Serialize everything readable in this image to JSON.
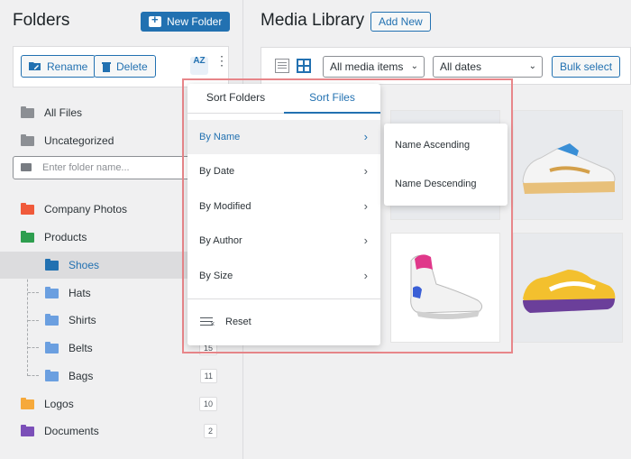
{
  "sidebar": {
    "title": "Folders",
    "new_folder_label": "New Folder",
    "rename_label": "Rename",
    "delete_label": "Delete",
    "sort_icon_text": "AZ",
    "items": [
      {
        "label": "All Files"
      },
      {
        "label": "Uncategorized"
      }
    ],
    "search_placeholder": "Enter folder name...",
    "folders": [
      {
        "label": "Company Photos",
        "color": "#f05a3b"
      },
      {
        "label": "Products",
        "color": "#2e9e4f"
      },
      {
        "label": "Shoes",
        "color": "#2271b1",
        "count": ""
      },
      {
        "label": "Hats",
        "color": "#6b9fe0",
        "count": ""
      },
      {
        "label": "Shirts",
        "color": "#6b9fe0",
        "count": ""
      },
      {
        "label": "Belts",
        "color": "#6b9fe0",
        "count": "15"
      },
      {
        "label": "Bags",
        "color": "#6b9fe0",
        "count": "11"
      },
      {
        "label": "Logos",
        "color": "#f6a93b",
        "count": "10"
      },
      {
        "label": "Documents",
        "color": "#7b4fb8",
        "count": "2"
      }
    ]
  },
  "media": {
    "title": "Media Library",
    "add_new_label": "Add New",
    "filter_items": "All media items",
    "filter_dates": "All dates",
    "bulk_select_label": "Bulk select"
  },
  "sort_panel": {
    "tab_folders": "Sort Folders",
    "tab_files": "Sort Files",
    "options": [
      {
        "label": "By Name"
      },
      {
        "label": "By Date"
      },
      {
        "label": "By Modified"
      },
      {
        "label": "By Author"
      },
      {
        "label": "By Size"
      }
    ],
    "reset_label": "Reset"
  },
  "sub_panel": {
    "options": [
      {
        "label": "Name Ascending"
      },
      {
        "label": "Name Descending"
      }
    ]
  },
  "colors": {
    "accent": "#2271b1",
    "highlight_border": "#e8868a"
  }
}
